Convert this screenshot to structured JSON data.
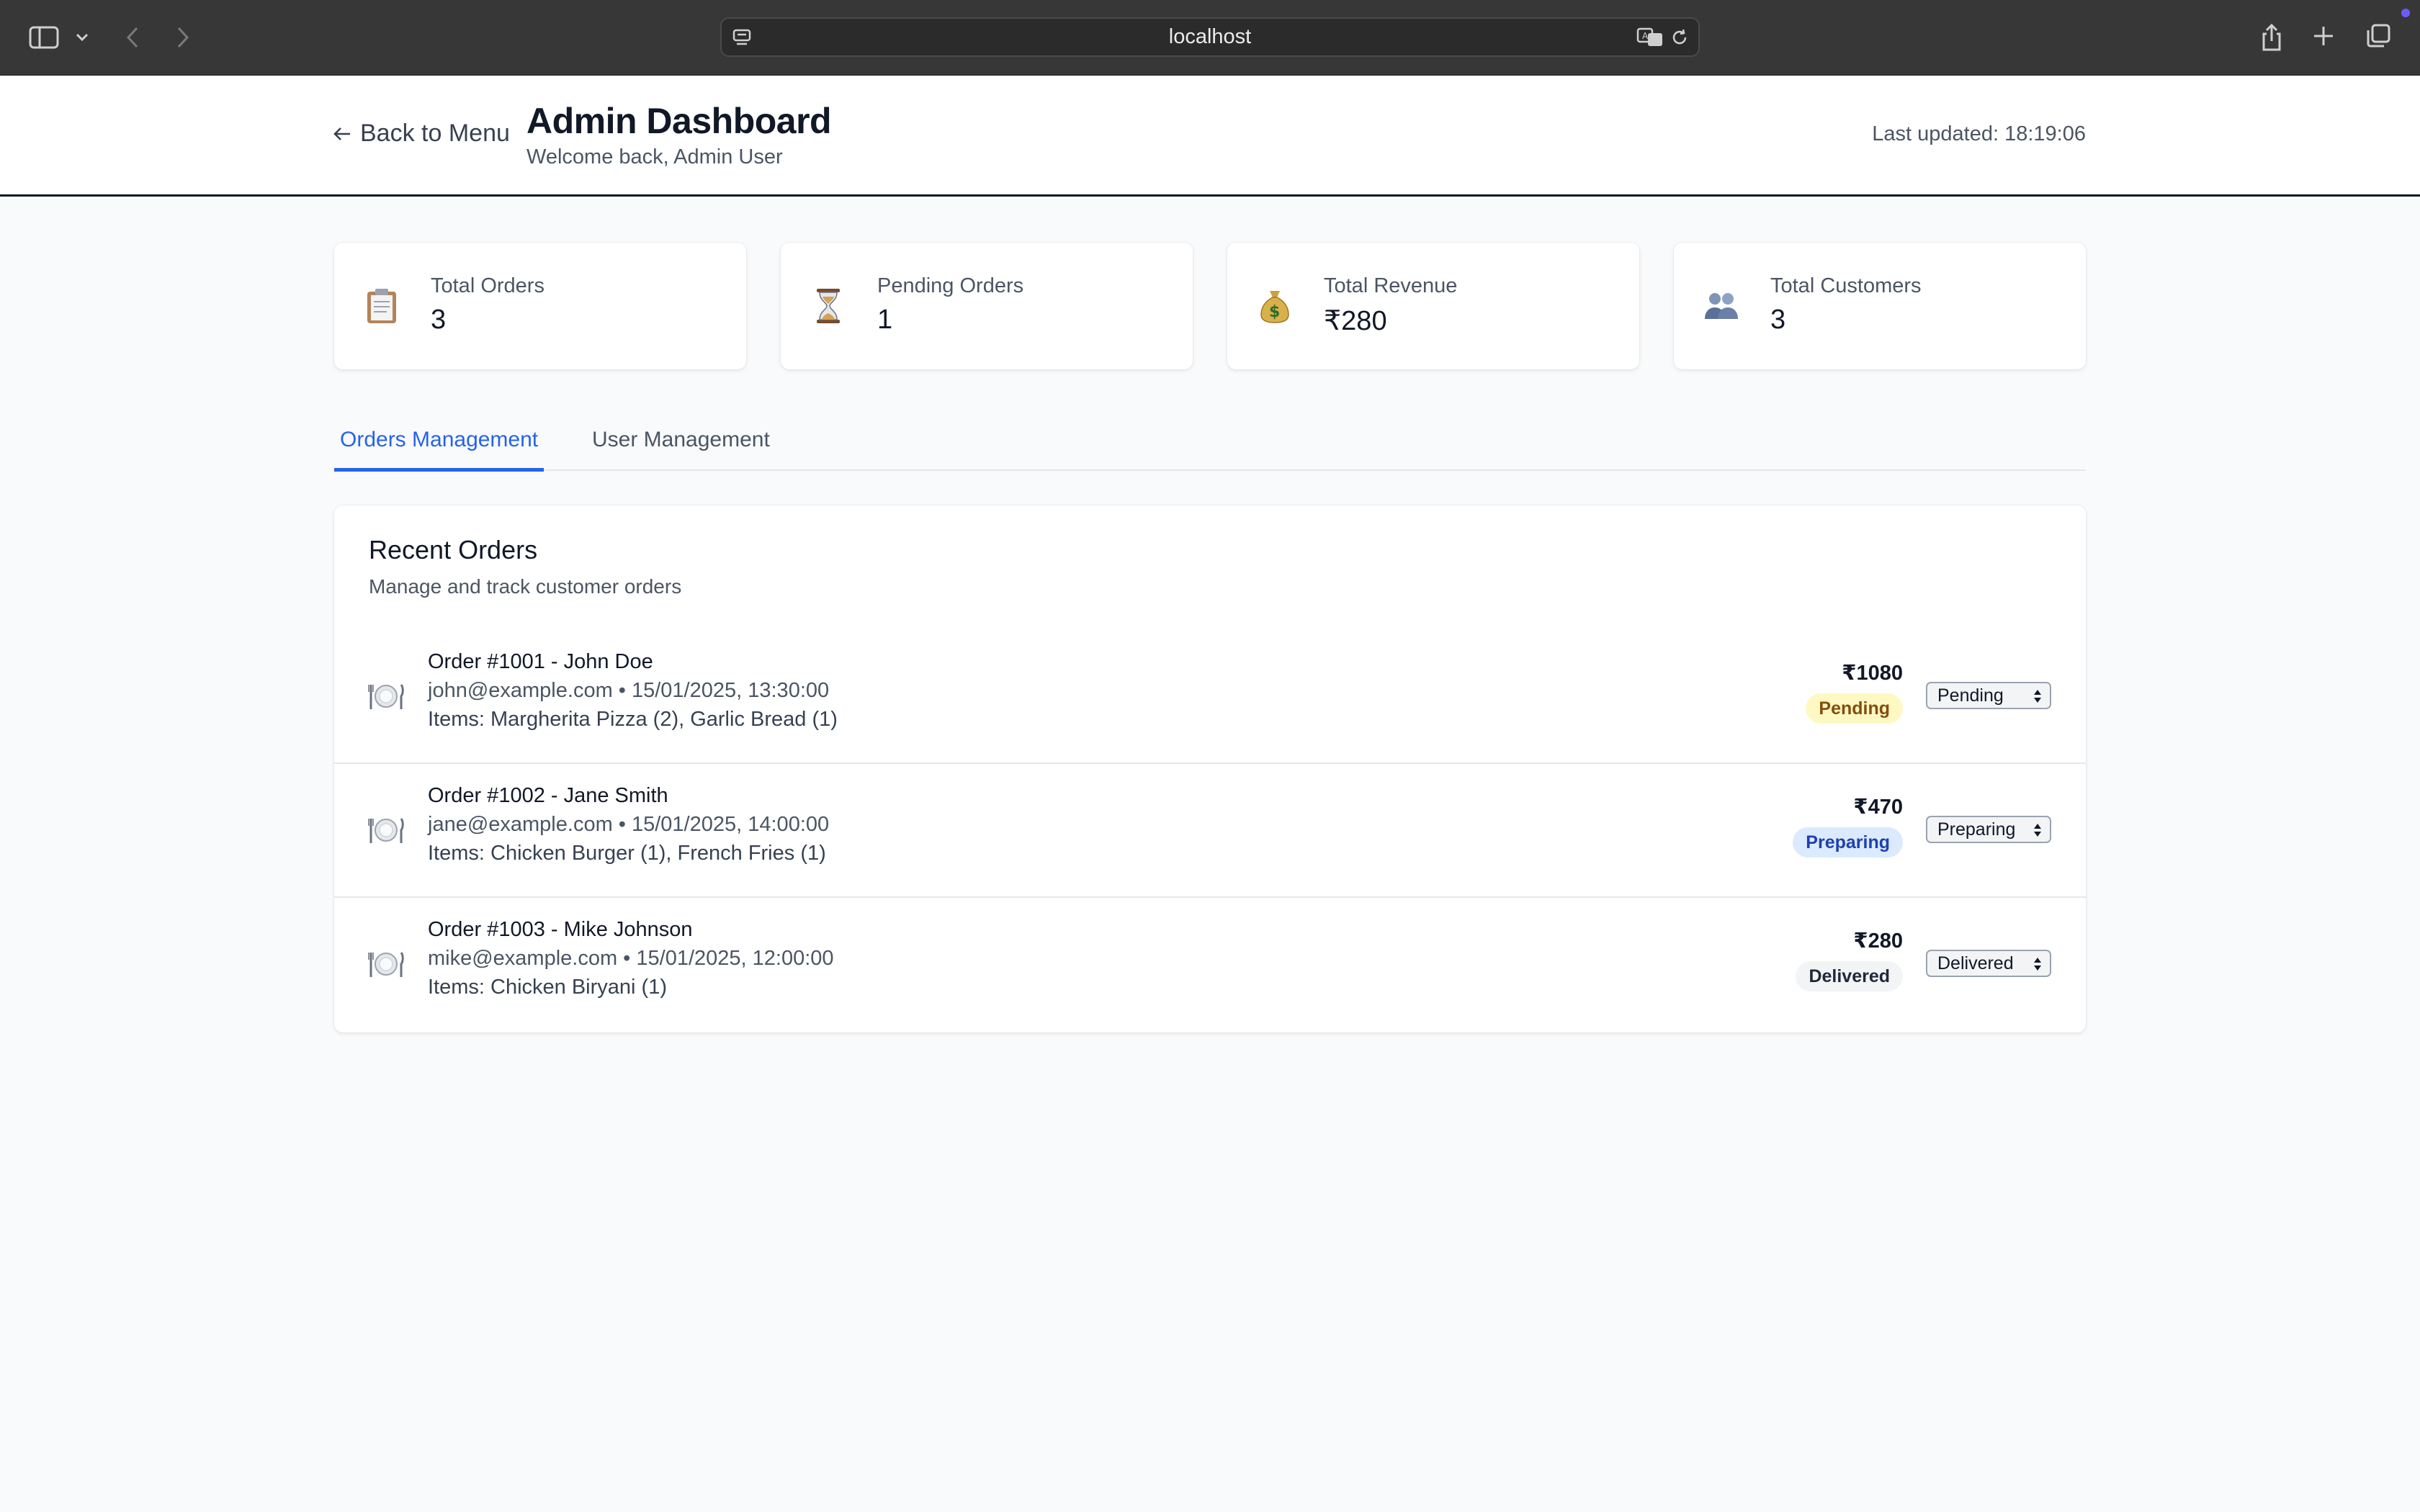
{
  "browser": {
    "url": "localhost"
  },
  "header": {
    "back_label": "Back to Menu",
    "title": "Admin Dashboard",
    "subtitle": "Welcome back, Admin User",
    "last_updated": "Last updated: 18:19:06"
  },
  "stats": [
    {
      "label": "Total Orders",
      "value": "3",
      "icon": "clipboard-icon"
    },
    {
      "label": "Pending Orders",
      "value": "1",
      "icon": "hourglass-icon"
    },
    {
      "label": "Total Revenue",
      "value": "₹280",
      "icon": "money-bag-icon"
    },
    {
      "label": "Total Customers",
      "value": "3",
      "icon": "users-icon"
    }
  ],
  "tabs": [
    {
      "label": "Orders Management",
      "active": true
    },
    {
      "label": "User Management",
      "active": false
    }
  ],
  "orders_panel": {
    "title": "Recent Orders",
    "subtitle": "Manage and track customer orders",
    "orders": [
      {
        "title": "Order #1001 - John Doe",
        "meta": "john@example.com • 15/01/2025, 13:30:00",
        "items": "Items: Margherita Pizza (2), Garlic Bread (1)",
        "amount": "₹1080",
        "status": "Pending",
        "selected": "Pending"
      },
      {
        "title": "Order #1002 - Jane Smith",
        "meta": "jane@example.com • 15/01/2025, 14:00:00",
        "items": "Items: Chicken Burger (1), French Fries (1)",
        "amount": "₹470",
        "status": "Preparing",
        "selected": "Preparing"
      },
      {
        "title": "Order #1003 - Mike Johnson",
        "meta": "mike@example.com • 15/01/2025, 12:00:00",
        "items": "Items: Chicken Biryani (1)",
        "amount": "₹280",
        "status": "Delivered",
        "selected": "Delivered"
      }
    ]
  },
  "colors": {
    "accent": "#2563eb",
    "pending_bg": "#fef9c3",
    "pending_text": "#854d0e",
    "preparing_bg": "#dbeafe",
    "preparing_text": "#1e40af",
    "delivered_bg": "#f3f4f6",
    "delivered_text": "#1f2937"
  }
}
